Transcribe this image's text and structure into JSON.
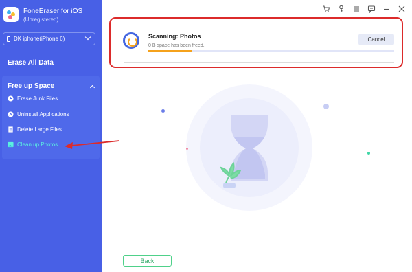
{
  "app": {
    "title": "FoneEraser for iOS",
    "subtitle": "(Unregistered)"
  },
  "device": {
    "selected": "DK iphone(iPhone 6)"
  },
  "sidebar": {
    "erase_all": "Erase All Data",
    "free_up_space": {
      "header": "Free up Space",
      "items": [
        {
          "label": "Erase Junk Files",
          "icon": "clock-icon"
        },
        {
          "label": "Uninstall Applications",
          "icon": "app-store-icon"
        },
        {
          "label": "Delete Large Files",
          "icon": "file-icon"
        },
        {
          "label": "Clean up Photos",
          "icon": "photo-icon",
          "active": true
        }
      ]
    }
  },
  "toolbar": {
    "icons": [
      "cart-icon",
      "key-icon",
      "menu-icon",
      "feedback-icon",
      "minimize-icon",
      "close-icon"
    ]
  },
  "scan": {
    "title": "Scanning: Photos",
    "status": "0 B space has been freed.",
    "cancel_label": "Cancel",
    "progress": 0.18
  },
  "footer": {
    "back_label": "Back"
  },
  "colors": {
    "sidebar": "#4860e6",
    "accent": "#f5a21c",
    "active_item": "#5af0e0",
    "highlight": "#dc2b2b",
    "back_border": "#4fd18a"
  }
}
